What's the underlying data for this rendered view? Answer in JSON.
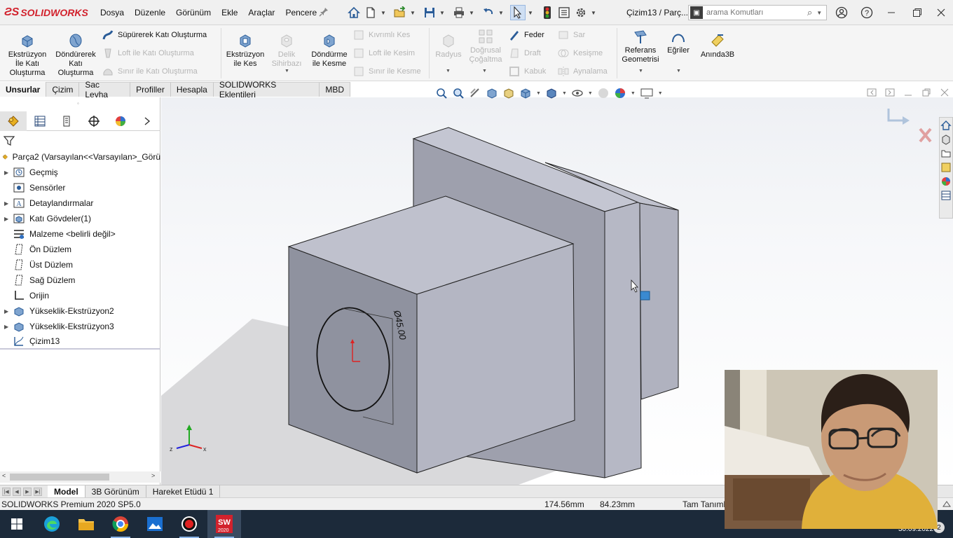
{
  "app": {
    "logo_brand": "SOLIDWORKS",
    "document_title": "Çizim13 / Parç..."
  },
  "menu": [
    "Dosya",
    "Düzenle",
    "Görünüm",
    "Ekle",
    "Araçlar",
    "Pencere"
  ],
  "search": {
    "placeholder": "arama Komutları"
  },
  "ribbon": {
    "extrude_boss": "Ekstrüzyon İle Katı Oluşturma",
    "revolve_boss": "Döndürerek Katı Oluşturma",
    "sweep_boss": "Süpürerek Katı Oluşturma",
    "loft_boss": "Loft ile Katı Oluşturma",
    "boundary_boss": "Sınır ile Katı Oluşturma",
    "extrude_cut": "Ekstrüzyon ile Kes",
    "hole_wizard": "Delik Sihirbazı",
    "revolve_cut": "Döndürme ile Kesme",
    "swept_cut": "Kıvrımlı Kes",
    "loft_cut": "Loft ile Kesim",
    "boundary_cut": "Sınır ile Kesme",
    "fillet": "Radyus",
    "linear_pattern": "Doğrusal Çoğaltma",
    "rib": "Feder",
    "draft": "Draft",
    "shell": "Kabuk",
    "wrap": "Sar",
    "intersect": "Kesişme",
    "mirror": "Aynalama",
    "ref_geometry": "Referans Geometrisi",
    "curves": "Eğriler",
    "instant3d": "Anında3B"
  },
  "command_tabs": [
    "Unsurlar",
    "Çizim",
    "Sac Levha",
    "Profiller",
    "Hesapla",
    "SOLIDWORKS Eklentileri",
    "MBD"
  ],
  "tree": {
    "root": "Parça2  (Varsayılan<<Varsayılan>_Görü",
    "items": [
      "Geçmiş",
      "Sensörler",
      "Detaylandırmalar",
      "Katı Gövdeler(1)",
      "Malzeme <belirli değil>",
      "Ön Düzlem",
      "Üst Düzlem",
      "Sağ Düzlem",
      "Orijin",
      "Yükseklik-Ekstrüzyon2",
      "Yükseklik-Ekstrüzyon3",
      "Çizim13"
    ]
  },
  "viewport": {
    "dimension": "Ø45.00",
    "axis_x": "x",
    "axis_z": "z"
  },
  "bottom_tabs": [
    "Model",
    "3B Görünüm",
    "Hareket Etüdü 1"
  ],
  "status": {
    "product": "SOLIDWORKS Premium 2020 SP5.0",
    "coord_x": "174.56mm",
    "coord_y": "84.23mm",
    "state": "Tam Tanıml"
  },
  "taskbar": {
    "sw_label": "2020",
    "date": "30.09.2022",
    "notif_count": "2"
  },
  "colors": {
    "brand_red": "#d2222d",
    "part_face_light": "#b9bcc9",
    "part_face_dark": "#8d909d",
    "taskbar_bg": "#1c2a3a"
  }
}
